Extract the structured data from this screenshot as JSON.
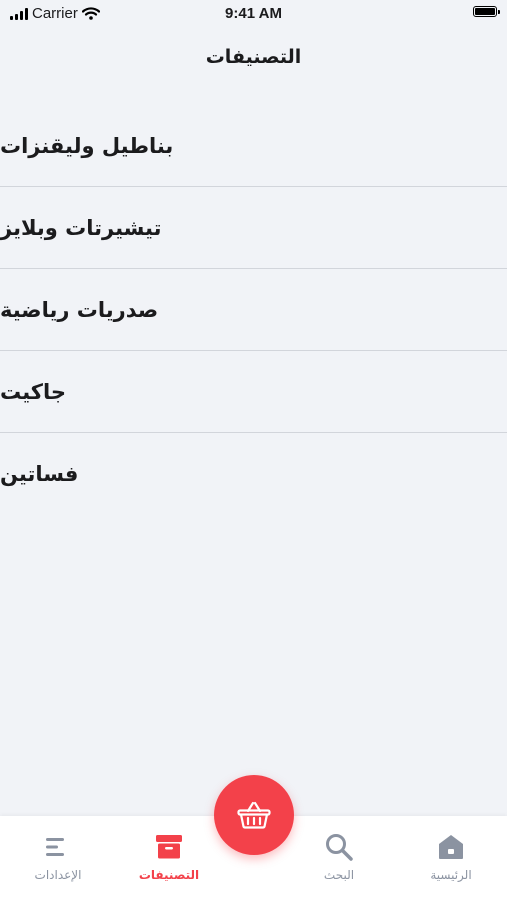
{
  "status_bar": {
    "carrier": "Carrier",
    "time": "9:41 AM"
  },
  "header": {
    "title": "التصنيفات"
  },
  "categories": [
    {
      "label": "بناطيل وليقنزات"
    },
    {
      "label": "تيشيرتات وبلايز"
    },
    {
      "label": "صدريات رياضية"
    },
    {
      "label": "جاكيت"
    },
    {
      "label": "فساتين"
    }
  ],
  "tab_bar": {
    "tabs": [
      {
        "label": "الإعدادات",
        "icon": "menu-lines-icon"
      },
      {
        "label": "التصنيفات",
        "icon": "archive-box-icon",
        "active": true
      },
      {
        "label": "البحث",
        "icon": "search-icon"
      },
      {
        "label": "الرئيسية",
        "icon": "home-icon"
      }
    ],
    "cart_icon": "basket-icon"
  },
  "colors": {
    "accent": "#f3414a",
    "inactive": "#8b93a1",
    "background": "#f1f3f7"
  }
}
